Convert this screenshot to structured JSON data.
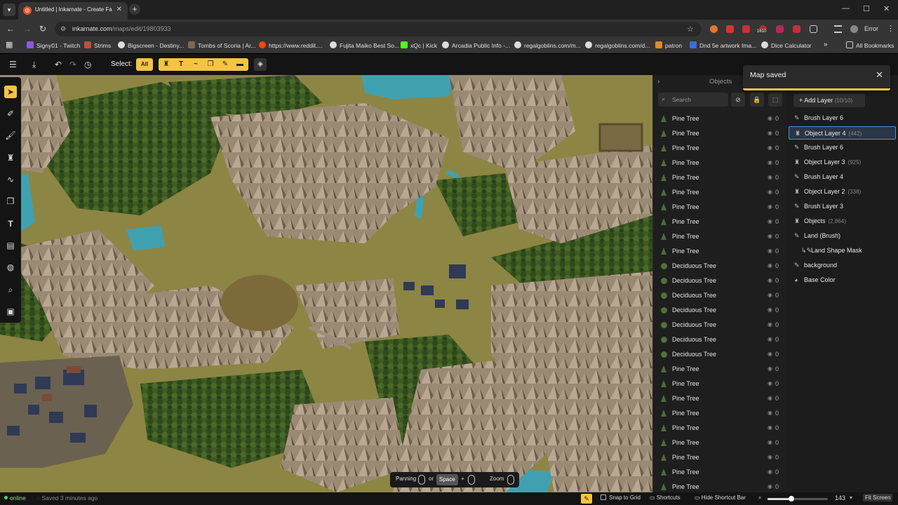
{
  "browser": {
    "tab_title": "Untitled | Inkarnate - Create Fa",
    "url_host": "inkarnate.com",
    "url_path": "/maps/edit/19803933",
    "profile": "Error",
    "bookmarks": [
      "Signy01 - Twitch",
      "Strims",
      "Bigscreen - Destiny...",
      "Tombs of Scoria | Ar...",
      "https://www.reddit....",
      "Fujita Maiko Best So...",
      "xQc | Kick",
      "Arcadia Public Info -...",
      "regalgoblins.com/m...",
      "regalgoblins.com/d...",
      "patron",
      "Dnd 5e artwork Ima...",
      "Dice Calculator"
    ],
    "all_bookmarks": "All Bookmarks",
    "ext_badge": "1610"
  },
  "toolbar": {
    "select_label": "Select:",
    "select_all": "All"
  },
  "objects_panel": {
    "title": "Objects",
    "search_placeholder": "Search",
    "rows": [
      {
        "name": "Pine Tree",
        "count": "0",
        "kind": "pine"
      },
      {
        "name": "Pine Tree",
        "count": "0",
        "kind": "pine"
      },
      {
        "name": "Pine Tree",
        "count": "0",
        "kind": "pine"
      },
      {
        "name": "Pine Tree",
        "count": "0",
        "kind": "pine"
      },
      {
        "name": "Pine Tree",
        "count": "0",
        "kind": "pine"
      },
      {
        "name": "Pine Tree",
        "count": "0",
        "kind": "pine"
      },
      {
        "name": "Pine Tree",
        "count": "0",
        "kind": "pine"
      },
      {
        "name": "Pine Tree",
        "count": "0",
        "kind": "pine"
      },
      {
        "name": "Pine Tree",
        "count": "0",
        "kind": "pine"
      },
      {
        "name": "Pine Tree",
        "count": "0",
        "kind": "pine"
      },
      {
        "name": "Deciduous Tree",
        "count": "0",
        "kind": "deciduous"
      },
      {
        "name": "Deciduous Tree",
        "count": "0",
        "kind": "deciduous"
      },
      {
        "name": "Deciduous Tree",
        "count": "0",
        "kind": "deciduous"
      },
      {
        "name": "Deciduous Tree",
        "count": "0",
        "kind": "deciduous"
      },
      {
        "name": "Deciduous Tree",
        "count": "0",
        "kind": "deciduous"
      },
      {
        "name": "Deciduous Tree",
        "count": "0",
        "kind": "deciduous"
      },
      {
        "name": "Deciduous Tree",
        "count": "0",
        "kind": "deciduous"
      },
      {
        "name": "Pine Tree",
        "count": "0",
        "kind": "pine"
      },
      {
        "name": "Pine Tree",
        "count": "0",
        "kind": "pine"
      },
      {
        "name": "Pine Tree",
        "count": "0",
        "kind": "pine"
      },
      {
        "name": "Pine Tree",
        "count": "0",
        "kind": "pine"
      },
      {
        "name": "Pine Tree",
        "count": "0",
        "kind": "pine"
      },
      {
        "name": "Pine Tree",
        "count": "0",
        "kind": "pine"
      },
      {
        "name": "Pine Tree",
        "count": "0",
        "kind": "pine"
      },
      {
        "name": "Pine Tree",
        "count": "0",
        "kind": "pine"
      },
      {
        "name": "Pine Tree",
        "count": "0",
        "kind": "pine"
      }
    ]
  },
  "layers_panel": {
    "add_layer": "Add Layer",
    "add_layer_count": "(10/10)",
    "layers": [
      {
        "name": "Brush Layer 6",
        "count": "",
        "icon": "brush-icon",
        "selected": false,
        "indent": false
      },
      {
        "name": "Object Layer 4",
        "count": "(442)",
        "icon": "object-layer-icon",
        "selected": true,
        "indent": false
      },
      {
        "name": "Brush Layer 6",
        "count": "",
        "icon": "brush-icon",
        "selected": false,
        "indent": false
      },
      {
        "name": "Object Layer 3",
        "count": "(925)",
        "icon": "object-layer-icon",
        "selected": false,
        "indent": false
      },
      {
        "name": "Brush Layer 4",
        "count": "",
        "icon": "brush-icon",
        "selected": false,
        "indent": false
      },
      {
        "name": "Object Layer 2",
        "count": "(338)",
        "icon": "object-layer-icon",
        "selected": false,
        "indent": false
      },
      {
        "name": "Brush Layer 3",
        "count": "",
        "icon": "brush-icon",
        "selected": false,
        "indent": false
      },
      {
        "name": "Objects",
        "count": "(2,864)",
        "icon": "object-layer-icon",
        "selected": false,
        "indent": false
      },
      {
        "name": "Land (Brush)",
        "count": "",
        "icon": "brush-icon",
        "selected": false,
        "indent": false
      },
      {
        "name": "Land Shape Mask",
        "count": "",
        "icon": "mask-icon",
        "selected": false,
        "indent": true
      },
      {
        "name": "background",
        "count": "",
        "icon": "brush-icon",
        "selected": false,
        "indent": false
      },
      {
        "name": "Base Color",
        "count": "",
        "icon": "palette-icon",
        "selected": false,
        "indent": false
      }
    ]
  },
  "toast": {
    "message": "Map saved"
  },
  "shortcut_bar": {
    "panning": "Panning",
    "or": "or",
    "space": "Space",
    "plus": "+",
    "zoom": "Zoom"
  },
  "status": {
    "online": "online",
    "saved": "Saved 3 minutes ago",
    "snap_to_grid": "Snap to Grid",
    "shortcuts": "Shortcuts",
    "hide_shortcut_bar": "Hide Shortcut Bar",
    "zoom_value": "143",
    "zoom_fraction": 0.4,
    "fit_screen": "Fit Screen"
  },
  "colors": {
    "accent": "#f6c343",
    "selected_border": "#4a8fd8",
    "online": "#4cd964"
  }
}
